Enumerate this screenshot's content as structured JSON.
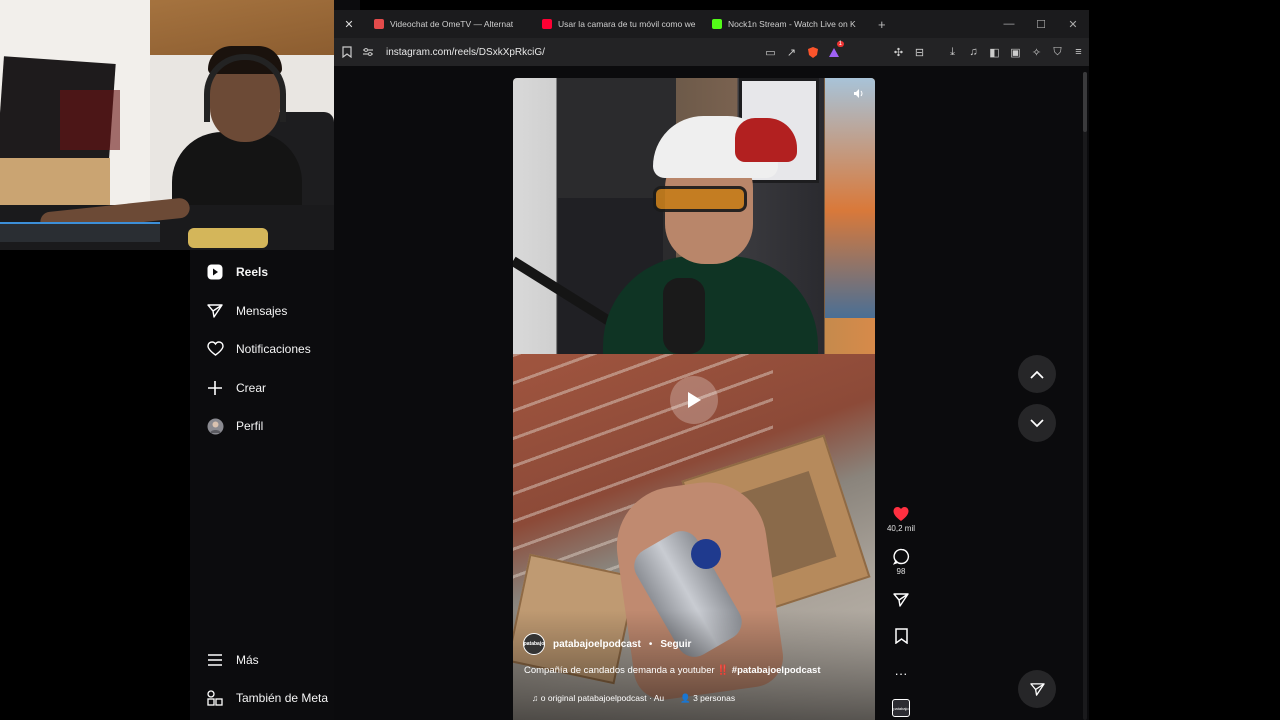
{
  "browser": {
    "tabs": [
      {
        "label": "Videochat de OmeTV — Alternat",
        "favicon_color": "#e34b4b"
      },
      {
        "label": "Usar la camara de tu móvil como we",
        "favicon_color": "#ff0033"
      },
      {
        "label": "Nock1n Stream - Watch Live on K",
        "favicon_color": "#53fc18"
      }
    ],
    "new_tab_symbol": "+",
    "url": "instagram.com/reels/DSxkXpRkciG/",
    "brave_badge": "1"
  },
  "sidebar": {
    "items": [
      {
        "label": "Reels",
        "icon": "reels-icon"
      },
      {
        "label": "Mensajes",
        "icon": "send-icon"
      },
      {
        "label": "Notificaciones",
        "icon": "heart-icon"
      },
      {
        "label": "Crear",
        "icon": "plus-icon"
      },
      {
        "label": "Perfil",
        "icon": "avatar"
      }
    ],
    "more_label": "Más",
    "meta_label": "También de Meta"
  },
  "reel": {
    "author": "patabajoelpodcast",
    "author_avatar_text": "patabajo",
    "separator": "•",
    "follow_label": "Seguir",
    "caption_text": "Compañía de candados demanda a youtuber",
    "caption_bang": "‼️",
    "caption_hashtag": "#patabajoelpodcast",
    "audio_text": "o original  patabajoelpodcast · Au",
    "people_text": "3 personas",
    "likes": "40,2 mil",
    "comments": "98"
  },
  "colors": {
    "accent_like": "#ff3040",
    "background": "#0b0b0d"
  }
}
